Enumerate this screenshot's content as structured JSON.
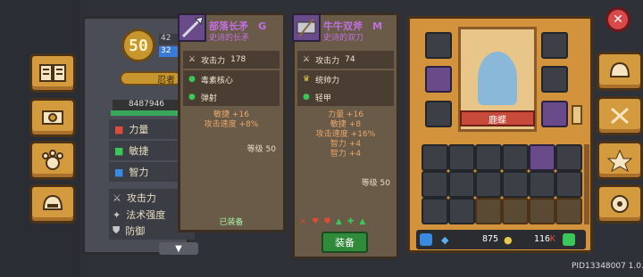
{
  "character": {
    "level": "50",
    "score": "8487946",
    "name_partial": "忍者",
    "exp_partial_1": "42",
    "exp_partial_2": "32",
    "attrs": [
      {
        "label": "力量"
      },
      {
        "label": "敏捷"
      },
      {
        "label": "智力"
      }
    ],
    "stats": [
      {
        "label": "攻击力"
      },
      {
        "label": "法术强度"
      },
      {
        "label": "防御"
      }
    ]
  },
  "card1": {
    "name": "部落长矛",
    "grade": "G",
    "subtitle": "史诗的长矛",
    "attack_label": "攻击力",
    "attack_value": "178",
    "lines": [
      "毒素核心",
      "弹射"
    ],
    "bonuses": [
      "敏捷 +16",
      "攻击速度 +8%"
    ],
    "level_label": "等级 50",
    "status": "已装备"
  },
  "card2": {
    "name": "牛牛双斧",
    "grade": "M",
    "subtitle": "史诗的双刀",
    "attack_label": "攻击力",
    "attack_value": "74",
    "lines": [
      "统帅力",
      "轻甲"
    ],
    "bonuses": [
      "力量 +16",
      "敏捷 +8",
      "攻击速度 +16%",
      "智力 +4",
      "智力 +4"
    ],
    "level_label": "等级 50",
    "equip_button": "装备"
  },
  "inventory": {
    "hero_name": "鹿蝶",
    "gems": "875",
    "coins": "116",
    "coins_suffix": "K"
  },
  "footer": {
    "pid": "PID13348007 1.0.19"
  },
  "colors": {
    "rarity_epic": "#c070e0",
    "panel_orange": "#d3923c",
    "bonus_orange": "#e8a86a",
    "close_red": "#d84a4a"
  }
}
